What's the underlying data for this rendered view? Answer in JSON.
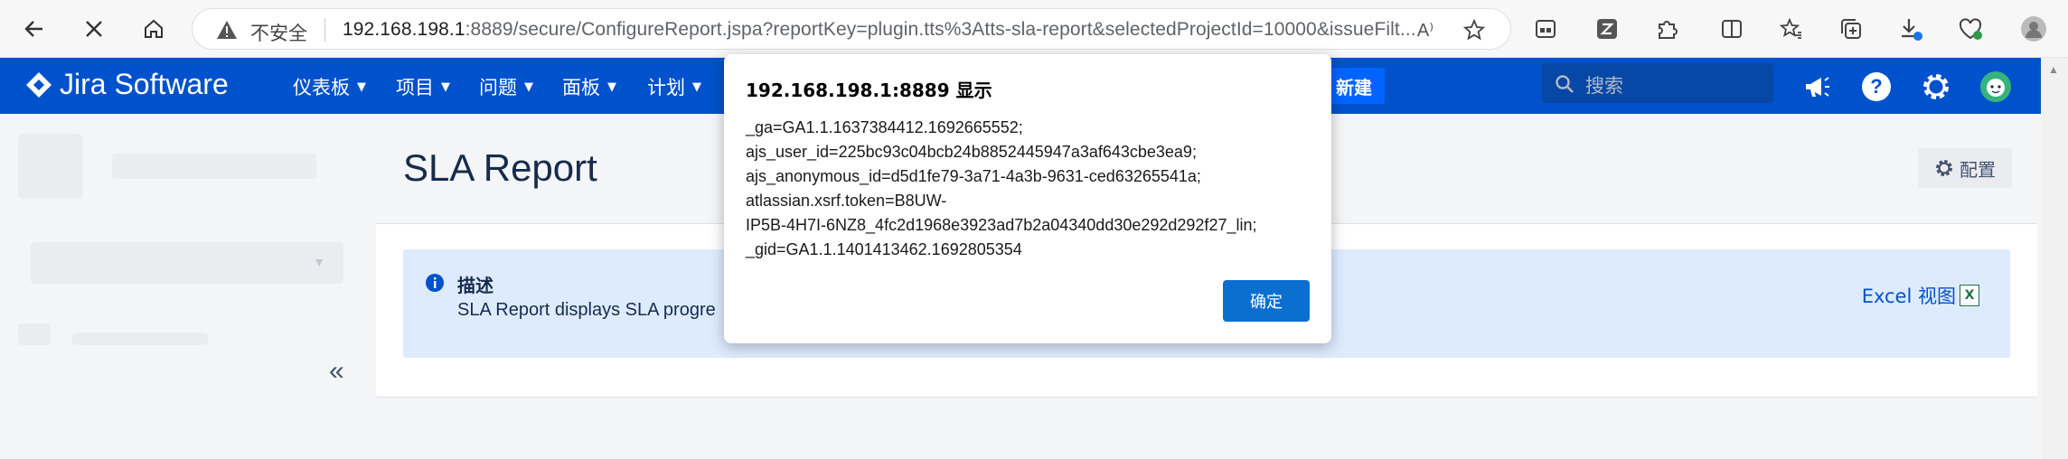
{
  "browser": {
    "insecure_label": "不安全",
    "url_host": "192.168.198.1",
    "url_rest": ":8889/secure/ConfigureReport.jspa?reportKey=plugin.tts%3Atts-sla-report&selectedProjectId=10000&issueFilt..."
  },
  "header": {
    "logo_text": "Jira Software",
    "menu": [
      {
        "label": "仪表板"
      },
      {
        "label": "项目"
      },
      {
        "label": "问题"
      },
      {
        "label": "面板"
      },
      {
        "label": "计划"
      }
    ],
    "create_label": "新建",
    "search_placeholder": "搜索",
    "colors": {
      "header_bg": "#0052cc",
      "create_bg": "#0065ff"
    }
  },
  "page": {
    "title": "SLA Report",
    "config_label": "配置",
    "info_title": "描述",
    "info_desc": "SLA Report displays SLA progre",
    "excel_label": "Excel 视图",
    "excel_icon_letter": "X"
  },
  "dialog": {
    "title": "192.168.198.1:8889 显示",
    "lines": [
      "_ga=GA1.1.1637384412.1692665552;",
      "ajs_user_id=225bc93c04bcb24b8852445947a3af643cbe3ea9;",
      "ajs_anonymous_id=d5d1fe79-3a71-4a3b-9631-ced63265541a;",
      "atlassian.xsrf.token=B8UW-",
      "IP5B-4H7I-6NZ8_4fc2d1968e3923ad7b2a04340dd30e292d292f27_lin;",
      "_gid=GA1.1.1401413462.1692805354"
    ],
    "ok_label": "确定"
  }
}
